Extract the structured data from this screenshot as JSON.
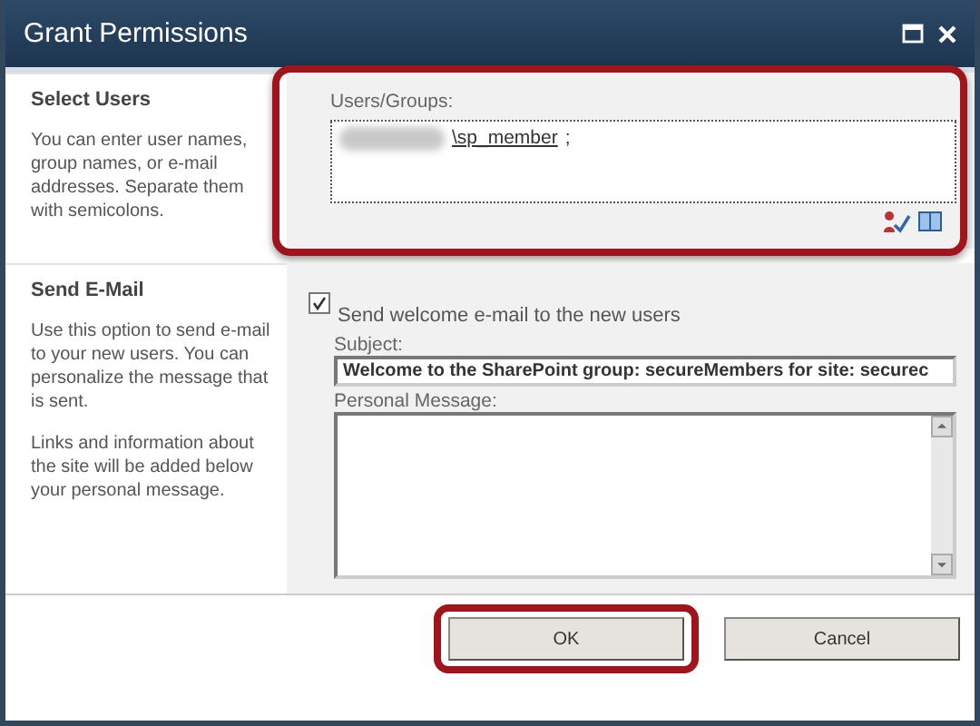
{
  "window": {
    "title": "Grant Permissions"
  },
  "select_users": {
    "heading": "Select Users",
    "description": "You can enter user names, group names, or e-mail addresses. Separate them with semicolons.",
    "field_label": "Users/Groups:",
    "entry": "\\sp_member",
    "separator": ";",
    "highlighted": true
  },
  "send_email": {
    "heading": "Send E-Mail",
    "descriptions": [
      "Use this option to send e-mail to your new users. You can personalize the message that is sent.",
      "Links and information about the site will be added below your personal message."
    ],
    "checkbox": {
      "label": "Send welcome e-mail to the new users",
      "checked": true
    },
    "subject": {
      "label": "Subject:",
      "value": "Welcome to the SharePoint group: secureMembers for site: securec"
    },
    "message": {
      "label": "Personal Message:"
    }
  },
  "buttons": [
    {
      "label": "OK",
      "highlighted": true
    },
    {
      "label": "Cancel",
      "highlighted": false
    }
  ]
}
